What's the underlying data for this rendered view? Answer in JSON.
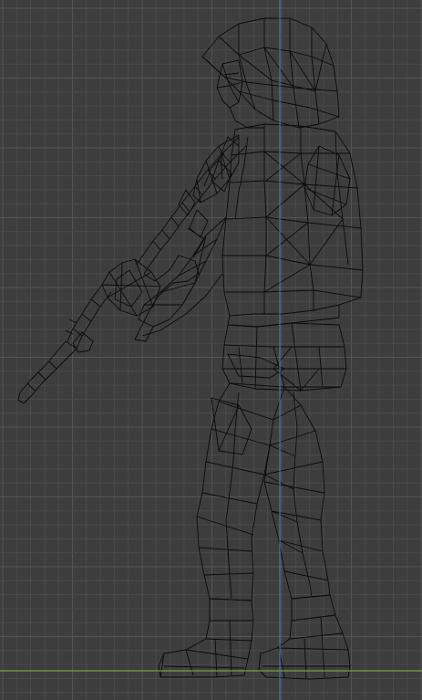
{
  "viewport": {
    "view": "side-orthographic",
    "shading_mode": "wireframe",
    "background_color": "#3d3d3d",
    "grid_minor_color": "#4a4a4a",
    "grid_major_color": "#545454",
    "wire_color": "#0b0b0b",
    "z_axis_color": "#4c7fd8",
    "ground_axis_color": "#8ab54a",
    "grid_visible": true
  },
  "object": {
    "name": "soldier-with-rifle",
    "display": "wireframe-mesh"
  }
}
